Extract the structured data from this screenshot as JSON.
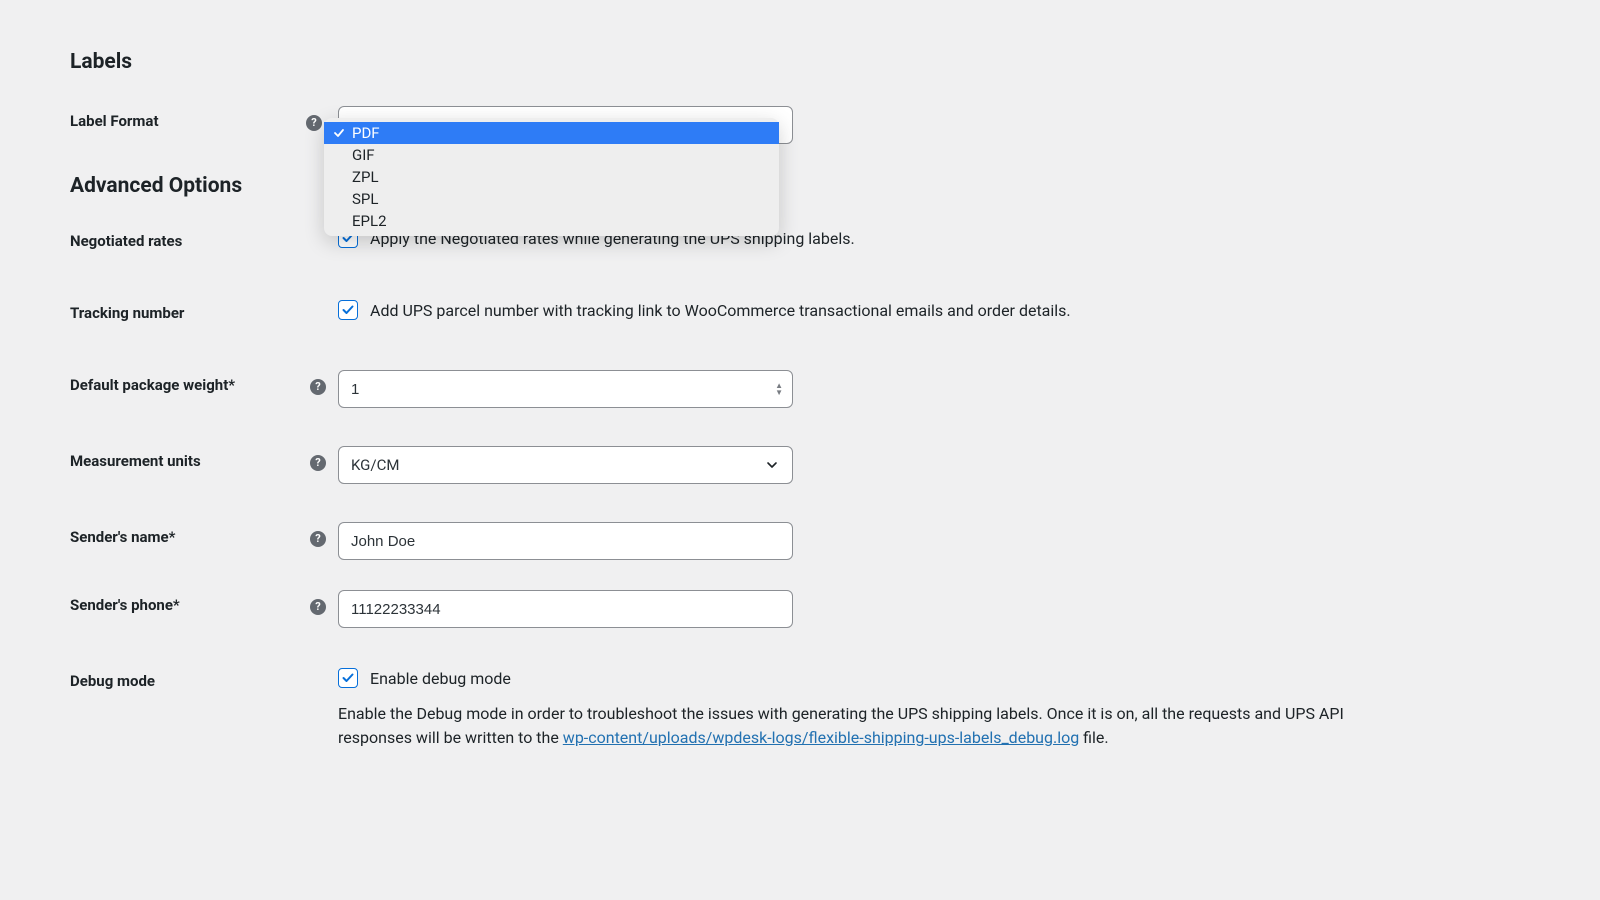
{
  "sections": {
    "labels_title": "Labels",
    "advanced_title": "Advanced Options"
  },
  "label_format": {
    "label": "Label Format",
    "options": [
      "PDF",
      "GIF",
      "ZPL",
      "SPL",
      "EPL2"
    ],
    "selected": "PDF"
  },
  "negotiated_rates": {
    "label": "Negotiated rates",
    "text": "Apply the Negotiated rates while generating the UPS shipping labels."
  },
  "tracking_number": {
    "label": "Tracking number",
    "text": "Add UPS parcel number with tracking link to WooCommerce transactional emails and order details."
  },
  "default_weight": {
    "label": "Default package weight*",
    "value": "1"
  },
  "measurement_units": {
    "label": "Measurement units",
    "value": "KG/CM"
  },
  "sender_name": {
    "label": "Sender's name*",
    "value": "John Doe"
  },
  "sender_phone": {
    "label": "Sender's phone*",
    "value": "11122233344"
  },
  "debug_mode": {
    "label": "Debug mode",
    "checkbox_text": "Enable debug mode",
    "description_pre": "Enable the Debug mode in order to troubleshoot the issues with generating the UPS shipping labels. Once it is on, all the requests and UPS API responses will be written to the ",
    "link_text": "wp-content/uploads/wpdesk-logs/flexible-shipping-ups-labels_debug.log",
    "description_post": " file."
  }
}
